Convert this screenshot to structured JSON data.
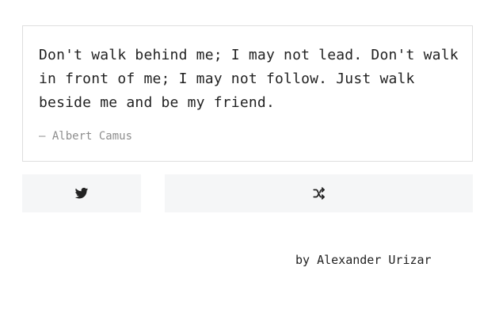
{
  "quote": {
    "text": "Don't walk behind me; I may not lead. Don't walk in front of me; I may not follow. Just walk beside me and be my friend.",
    "author": "— Albert Camus"
  },
  "actions": {
    "tweet_icon": "twitter-icon",
    "shuffle_icon": "shuffle-icon"
  },
  "footer": {
    "credit": "by Alexander Urizar"
  },
  "colors": {
    "text": "#222222",
    "author": "#8e8e8e",
    "button_bg": "#f5f6f7",
    "border": "#dedede"
  }
}
